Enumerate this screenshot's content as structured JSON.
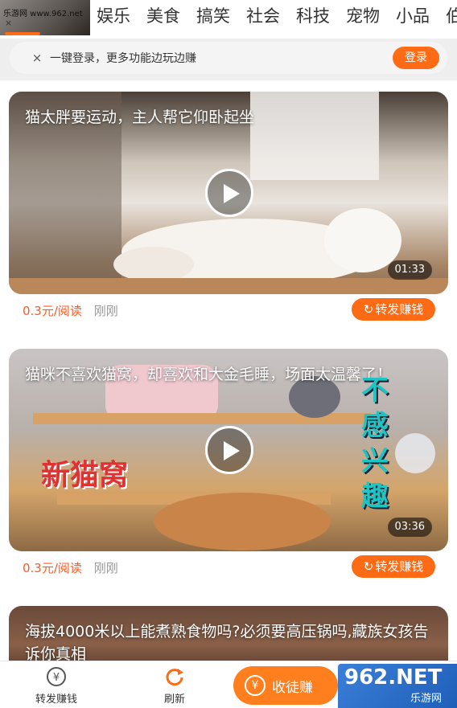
{
  "topbar": {
    "watermark_text": "乐游网 www.962.net",
    "close_glyph": "×",
    "categories": [
      "娱乐",
      "美食",
      "搞笑",
      "社会",
      "科技",
      "宠物",
      "小品",
      "伯"
    ]
  },
  "login_strip": {
    "close_glyph": "×",
    "text": "一键登录，更多功能边玩边赚",
    "button": "登录"
  },
  "cards": [
    {
      "title": "猫太胖要运动，主人帮它仰卧起坐",
      "duration": "01:33",
      "price": "0.3元/阅读",
      "time": "刚刚",
      "share": "转发赚钱"
    },
    {
      "title": "猫咪不喜欢猫窝，却喜欢和大金毛睡，场面太温馨了！",
      "duration": "03:36",
      "price": "0.3元/阅读",
      "time": "刚刚",
      "share": "转发赚钱",
      "overlay_left": "新猫窝",
      "overlay_right": "不感兴趣"
    },
    {
      "title": "海拔4000米以上能煮熟食物吗?必须要高压锅吗,藏族女孩告诉你真相"
    }
  ],
  "bottom_nav": {
    "share_earn": "转发赚钱",
    "refresh": "刷新",
    "recruit": "收徒赚",
    "yen_glyph": "¥"
  },
  "site_watermark": {
    "big": "962.NET",
    "small": "乐游网"
  },
  "colors": {
    "accent": "#ff6a14",
    "price": "#ff5a1f"
  }
}
